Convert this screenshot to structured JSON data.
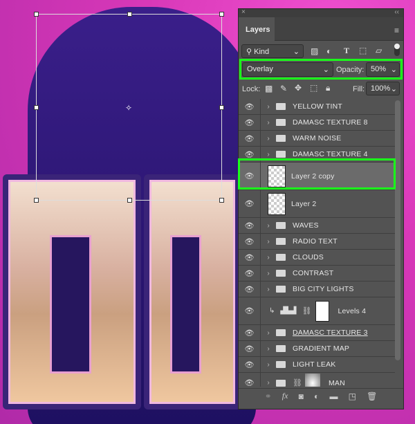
{
  "panel": {
    "title": "Layers",
    "close": "×",
    "collapse": "‹‹",
    "menu": "≡"
  },
  "filter": {
    "kind": "Kind",
    "icons": [
      "image-filter-icon",
      "adjustment-filter-icon",
      "type-filter-icon",
      "shape-filter-icon",
      "smart-object-filter-icon",
      "filter-toggle-icon"
    ]
  },
  "blend": {
    "mode": "Overlay",
    "opacity_label": "Opacity:",
    "opacity": "50%"
  },
  "lock": {
    "label": "Lock:",
    "fill_label": "Fill:",
    "fill": "100%"
  },
  "layers": [
    {
      "name": "YELLOW TINT",
      "type": "group"
    },
    {
      "name": "DAMASC TEXTURE 8",
      "type": "group"
    },
    {
      "name": "WARM NOISE",
      "type": "group"
    },
    {
      "name": "DAMASC TEXTURE 4",
      "type": "group"
    },
    {
      "name": "Layer 2 copy",
      "type": "layer",
      "selected": true
    },
    {
      "name": "Layer 2",
      "type": "layer"
    },
    {
      "name": "WAVES",
      "type": "group"
    },
    {
      "name": "RADIO TEXT",
      "type": "group"
    },
    {
      "name": "CLOUDS",
      "type": "group"
    },
    {
      "name": "CONTRAST",
      "type": "group"
    },
    {
      "name": "BIG CITY LIGHTS",
      "type": "group"
    },
    {
      "name": "Levels 4",
      "type": "adjustment"
    },
    {
      "name": "DAMASC TEXTURE 3",
      "type": "group"
    },
    {
      "name": "GRADIENT MAP",
      "type": "group"
    },
    {
      "name": "LIGHT LEAK",
      "type": "group"
    },
    {
      "name": "MAN",
      "type": "group-masked"
    }
  ],
  "footer": {
    "fx": "fx"
  },
  "colors": {
    "highlight": "#1aff1a",
    "panel": "#535353"
  }
}
